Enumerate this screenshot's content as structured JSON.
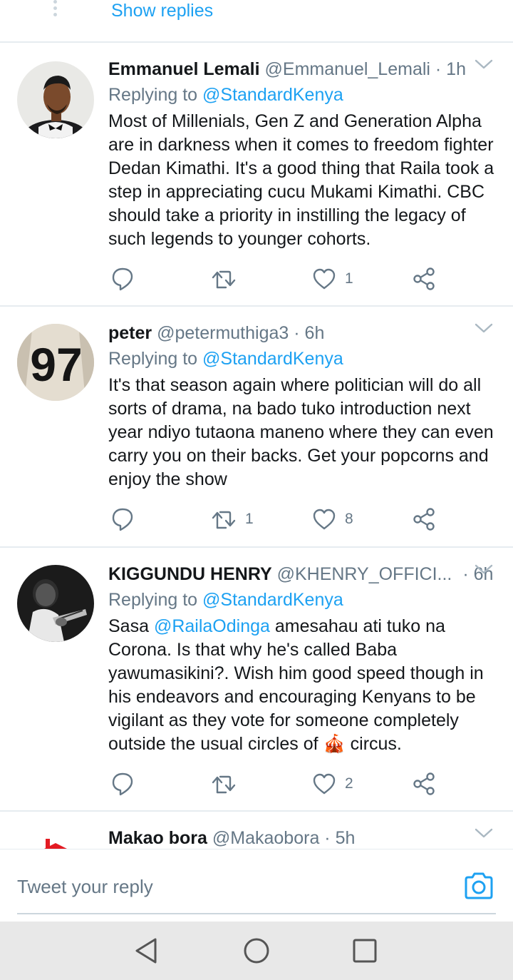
{
  "show_replies": {
    "label": "Show replies"
  },
  "tweets": [
    {
      "name": "Emmanuel Lemali",
      "handle": "@Emmanuel_Lemali",
      "time": "· 1h",
      "replying_prefix": "Replying to",
      "replying_to": "@StandardKenya",
      "body": "Most of Millenials, Gen Z and Generation Alpha are in darkness when it comes to freedom fighter Dedan Kimathi. It's a good thing that Raila took a step in appreciating cucu Mukami Kimathi. CBC should take a priority in instilling the legacy of such legends to younger cohorts.",
      "retweets": "",
      "likes": "1"
    },
    {
      "name": "peter",
      "handle": "@petermuthiga3",
      "time": "· 6h",
      "replying_prefix": "Replying to",
      "replying_to": "@StandardKenya",
      "body": "It's that season again where politician will do all sorts of drama, na bado tuko introduction next year ndiyo tutaona maneno where they can even carry you on their backs. Get your popcorns and enjoy the show",
      "retweets": "1",
      "likes": "8"
    },
    {
      "name": "KIGGUNDU HENRY",
      "handle": "@KHENRY_OFFICI...",
      "time": "· 6h",
      "replying_prefix": "Replying to",
      "replying_to": "@StandardKenya",
      "body_before": "Sasa ",
      "body_mention": "@RailaOdinga",
      "body_after": " amesahau ati tuko na Corona. Is that why he's called Baba yawumasikini?. Wish him good speed though in his endeavors and encouraging Kenyans to be vigilant as they vote for someone completely outside the usual circles of ",
      "body_emoji": "🎪",
      "body_end": " circus.",
      "retweets": "",
      "likes": "2"
    },
    {
      "name": "Makao bora",
      "handle": "@Makaobora",
      "time": "· 5h"
    }
  ],
  "reply_bar": {
    "placeholder": "Tweet your reply"
  },
  "avatar_texts": {
    "jersey_number": "97"
  },
  "icons": {
    "reply": "reply-icon",
    "retweet": "retweet-icon",
    "like": "heart-icon",
    "share": "share-icon",
    "caret": "chevron-down-icon",
    "camera": "camera-icon"
  },
  "colors": {
    "accent": "#1da1f2",
    "secondary_text": "#657786",
    "divider": "#e6ecf0"
  }
}
